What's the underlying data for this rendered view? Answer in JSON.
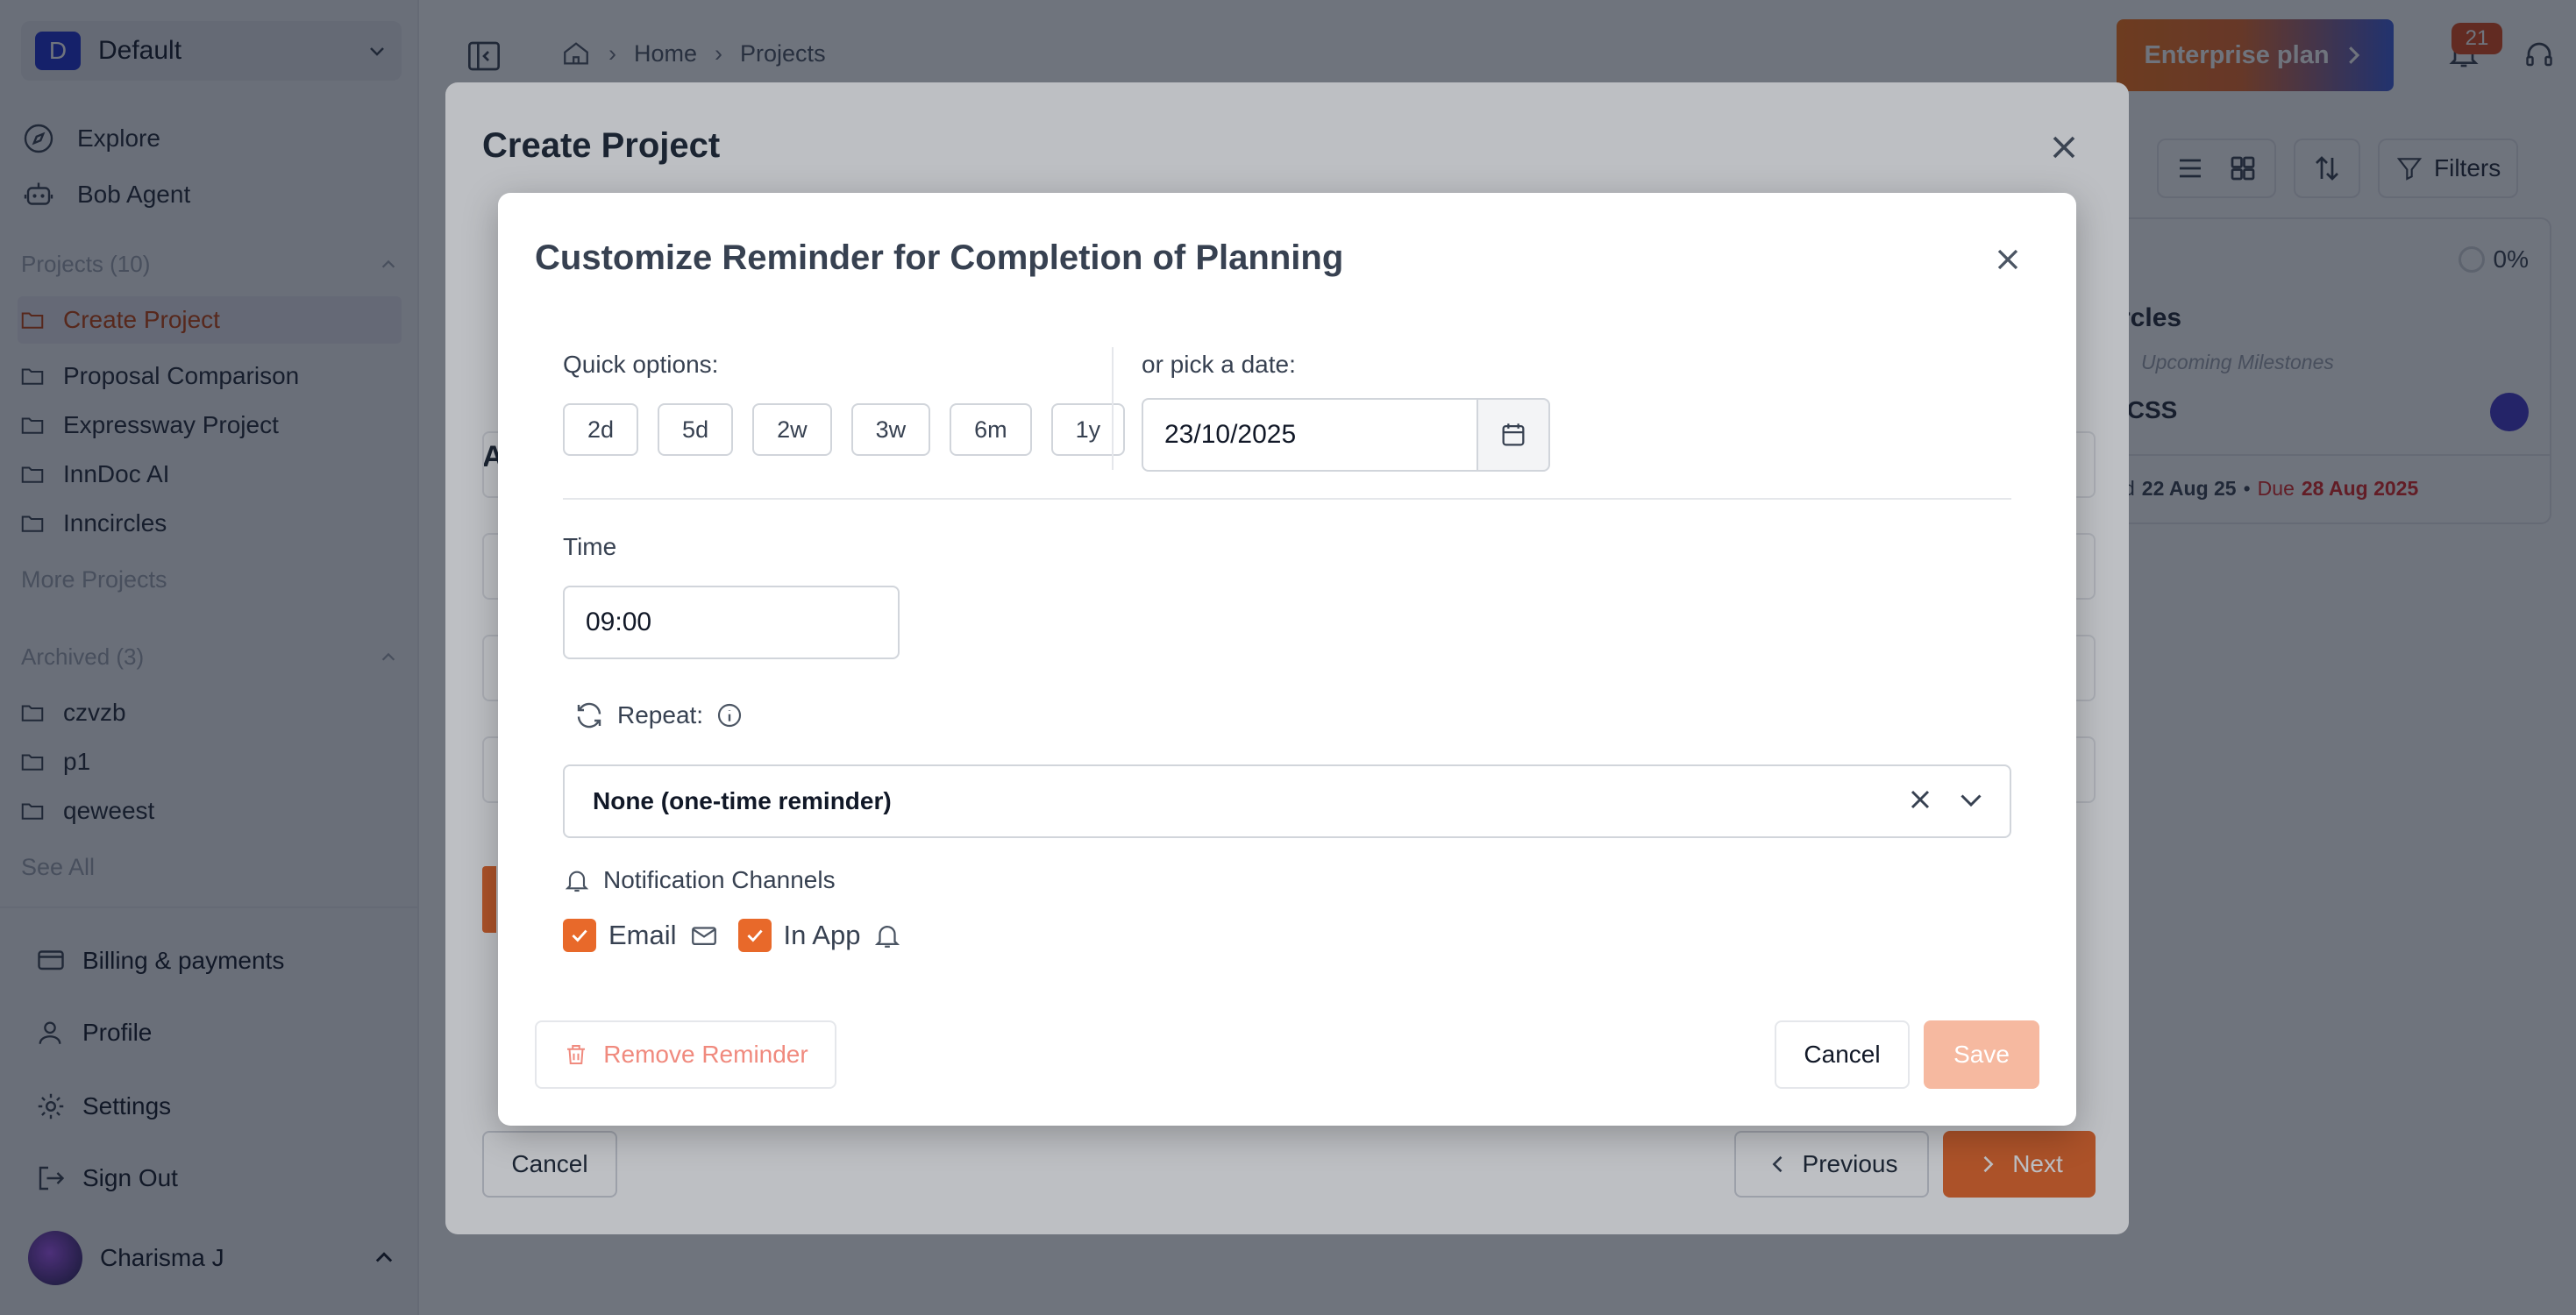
{
  "workspace": {
    "badge": "D",
    "name": "Default"
  },
  "nav": {
    "explore": "Explore",
    "agent": "Bob Agent"
  },
  "projects": {
    "title": "Projects (10)",
    "items": [
      "Create Project",
      "Proposal Comparison",
      "Expressway Project",
      "InnDoc AI",
      "Inncircles"
    ],
    "more": "More Projects"
  },
  "archived": {
    "title": "Archived (3)",
    "items": [
      "czvzb",
      "p1",
      "qeweest"
    ],
    "see_all": "See All"
  },
  "bottom_nav": {
    "billing": "Billing & payments",
    "profile": "Profile",
    "settings": "Settings",
    "signout": "Sign Out"
  },
  "user": {
    "name": "Charisma J"
  },
  "breadcrumb": {
    "home": "Home",
    "projects": "Projects"
  },
  "header": {
    "enterprise": "Enterprise plan",
    "notifications": "21"
  },
  "toolbar": {
    "filters": "Filters"
  },
  "card": {
    "progress": "0%",
    "title": "rcles",
    "milestones": "Upcoming Milestones",
    "tag": "ICSS",
    "date_prefix": "d",
    "start": "22 Aug 25",
    "due_label": "Due",
    "due": "28 Aug 2025"
  },
  "create_project": {
    "title": "Create Project",
    "section_letter": "A",
    "cancel": "Cancel",
    "previous": "Previous",
    "next": "Next"
  },
  "reminder": {
    "title": "Customize Reminder for Completion of Planning",
    "quick_label": "Quick options:",
    "quick_options": [
      "2d",
      "5d",
      "2w",
      "3w",
      "6m",
      "1y"
    ],
    "date_label": "or pick a date:",
    "date_value": "23/10/2025",
    "time_label": "Time",
    "time_value": "09:00",
    "repeat_label": "Repeat:",
    "repeat_value": "None (one-time reminder)",
    "channels_label": "Notification Channels",
    "email": "Email",
    "inapp": "In App",
    "remove": "Remove Reminder",
    "cancel": "Cancel",
    "save": "Save"
  },
  "colors": {
    "accent": "#e8692a",
    "brand_blue": "#1d2fd0"
  }
}
